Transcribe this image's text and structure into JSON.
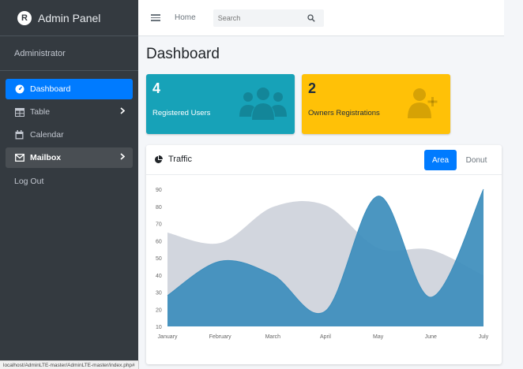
{
  "brand": {
    "title": "Admin Panel",
    "logo_letter": "R"
  },
  "user": {
    "name": "Administrator"
  },
  "sidebar": {
    "items": [
      {
        "label": "Dashboard",
        "icon": "tachometer-icon",
        "state": "active"
      },
      {
        "label": "Table",
        "icon": "table-icon",
        "has_submenu": true
      },
      {
        "label": "Calendar",
        "icon": "calendar-icon"
      },
      {
        "label": "Mailbox",
        "icon": "envelope-icon",
        "has_submenu": true,
        "state": "open"
      },
      {
        "label": "Log Out"
      }
    ]
  },
  "header": {
    "home_label": "Home",
    "search_placeholder": "Search"
  },
  "page": {
    "title": "Dashboard"
  },
  "stats": [
    {
      "value": "4",
      "label": "Registered Users",
      "color": "#17a2b8",
      "icon": "users-icon"
    },
    {
      "value": "2",
      "label": "Owners Registrations",
      "color": "#ffc107",
      "icon": "user-plus-icon"
    }
  ],
  "traffic": {
    "title": "Traffic",
    "tabs": [
      "Area",
      "Donut"
    ],
    "active_tab": "Area"
  },
  "chart_data": {
    "type": "area",
    "x": [
      "January",
      "February",
      "March",
      "April",
      "May",
      "June",
      "July"
    ],
    "yticks": [
      10,
      20,
      30,
      40,
      50,
      60,
      70,
      80,
      90
    ],
    "ylim": [
      10,
      90
    ],
    "series": [
      {
        "values": [
          65,
          59,
          80,
          81,
          56,
          55,
          40
        ],
        "color": "#d2d6de"
      },
      {
        "values": [
          28,
          48,
          40,
          19,
          86,
          27,
          90
        ],
        "color": "#3c8dbc"
      }
    ]
  },
  "status_bar": {
    "url": "localhost/AdminLTE-master/AdminLTE-master/index.php#"
  },
  "colors": {
    "sidebar_bg": "#343a40",
    "primary": "#007bff",
    "info": "#17a2b8",
    "warning": "#ffc107",
    "content_bg": "#f4f6f9"
  }
}
